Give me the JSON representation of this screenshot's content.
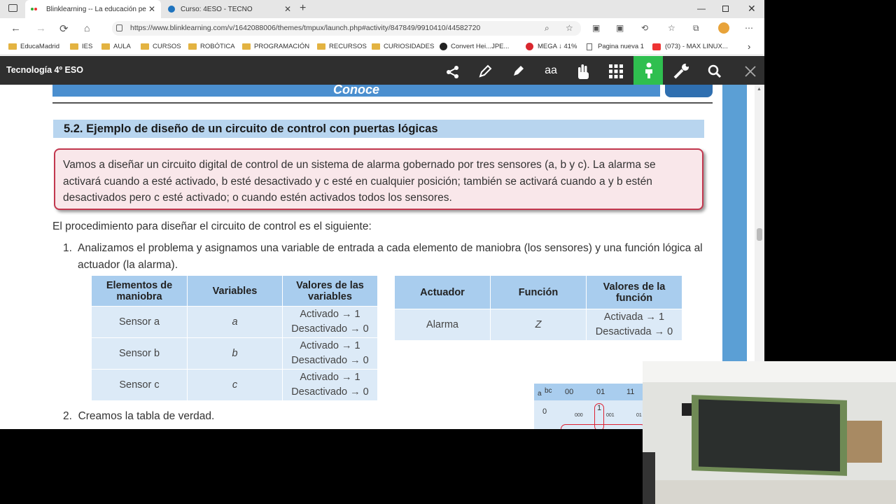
{
  "browser": {
    "tabs": [
      {
        "title": "Blinklearning -- La educación pe",
        "active": true
      },
      {
        "title": "Curso: 4ESO - TECNO",
        "active": false
      }
    ],
    "url": "https://www.blinklearning.com/v/1642088006/themes/tmpux/launch.php#activity/847849/9910410/44582720",
    "bookmarks": [
      "EducaMadrid",
      "IES",
      "AULA",
      "CURSOS",
      "ROBÓTICA",
      "PROGRAMACIÓN",
      "RECURSOS",
      "CURIOSIDADES",
      "Convert Hei...JPE...",
      "MEGA ↓ 41%",
      "Pagina nueva 1",
      "(073) - MAX LINUX..."
    ]
  },
  "app": {
    "title": "Tecnología 4º ESO",
    "highlight_color": "#2fbf4f"
  },
  "page": {
    "banner": "Conoce",
    "section_title": "5.2. Ejemplo de diseño de un circuito de control con puertas lógicas",
    "box_lines": [
      "Vamos a diseñar un circuito digital de control de un sistema de alarma gobernado por tres sensores (a, b y c). La alarma se",
      "activará cuando a esté activado, b esté desactivado y c esté en cualquier posición; también se activará cuando a y b estén",
      "desactivados pero c esté activado; o cuando estén activados todos los sensores."
    ],
    "intro": "El procedimiento para diseñar el circuito de control es el siguiente:",
    "step1_num": "1.",
    "step1_text": "Analizamos el problema y asignamos una variable de entrada a cada elemento de maniobra (los sensores) y una función lógica al actuador (la alarma).",
    "step2_num": "2.",
    "step2_text": "Creamos la tabla de verdad.",
    "table1": {
      "headers": [
        "Elementos de maniobra",
        "Variables",
        "Valores de las variables"
      ],
      "rows": [
        [
          "Sensor a",
          "a",
          "Activado → 1",
          "Desactivado → 0"
        ],
        [
          "Sensor b",
          "b",
          "Activado → 1",
          "Desactivado → 0"
        ],
        [
          "Sensor c",
          "c",
          "Activado → 1",
          "Desactivado → 0"
        ]
      ]
    },
    "table2": {
      "headers": [
        "Actuador",
        "Función",
        "Valores de la función"
      ],
      "rows": [
        [
          "Alarma",
          "Z",
          "Activada → 1",
          "Desactivada → 0"
        ]
      ]
    },
    "kmap": {
      "corner_a": "a",
      "corner_bc": "bc",
      "cols": [
        "00",
        "01",
        "11"
      ],
      "row0": "0",
      "cell_val": "1",
      "sub1": "000",
      "sub2": "001",
      "sub3": "01"
    }
  }
}
